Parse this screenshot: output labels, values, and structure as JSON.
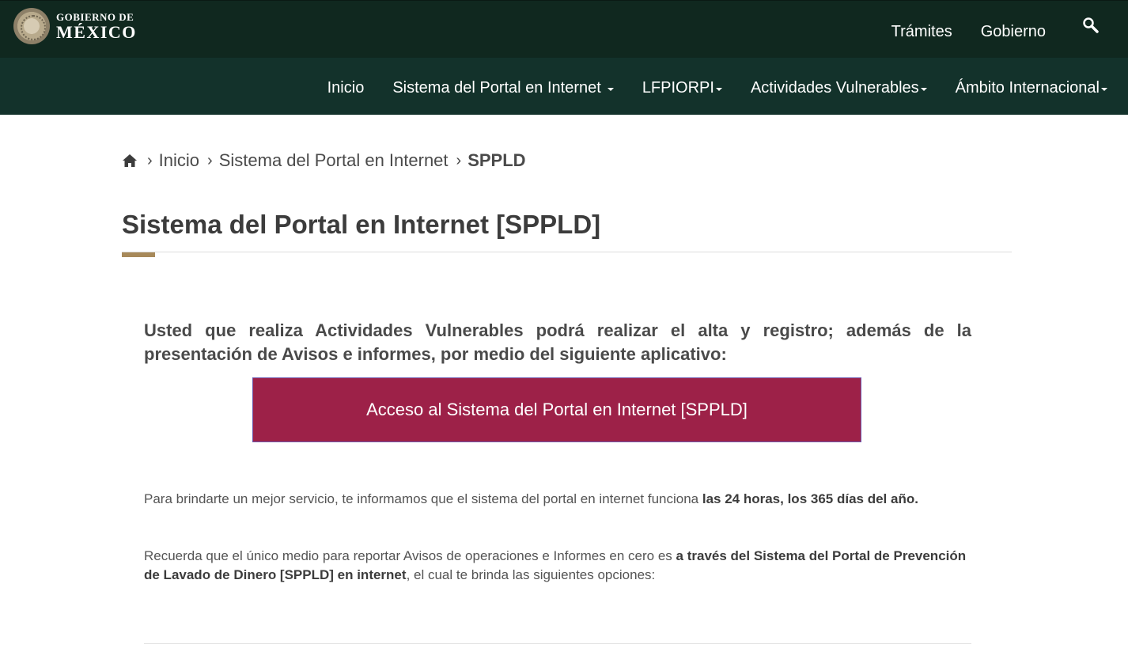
{
  "header": {
    "logo_small": "GOBIERNO DE",
    "logo_big": "MÉXICO",
    "links": [
      "Trámites",
      "Gobierno"
    ],
    "search_icon": "search-icon"
  },
  "nav": {
    "items": [
      {
        "label": "Inicio"
      },
      {
        "label": "Sistema del Portal en Internet"
      },
      {
        "label": "LFPIORPI"
      },
      {
        "label": "Actividades Vulnerables"
      },
      {
        "label": "Ámbito Internacional"
      }
    ]
  },
  "breadcrumb": {
    "home_icon": "home-icon",
    "items": [
      "Inicio",
      "Sistema del Portal en Internet",
      "SPPLD"
    ]
  },
  "page": {
    "title": "Sistema del Portal en Internet [SPPLD]",
    "intro": "Usted que realiza Actividades Vulnerables podrá realizar el alta y registro; además de la presentación de Avisos e informes, por medio del siguiente aplicativo:",
    "button_label": "Acceso al Sistema del Portal en Internet [SPPLD]",
    "p1_text": "Para brindarte un mejor servicio, te informamos que el sistema del portal en internet funciona ",
    "p1_bold": "las 24 horas, los 365 días del año.",
    "p2_text": "Recuerda que el único medio para reportar Avisos de operaciones e Informes en cero es ",
    "p2_bold": "a través del Sistema del Portal de Prevención de Lavado de Dinero [SPPLD] en internet",
    "p2_tail": ", el cual te brinda las siguientes opciones:"
  },
  "colors": {
    "topbar": "#10281f",
    "navbar": "#13322b",
    "button": "#9d2148",
    "accent": "#a7895a"
  }
}
